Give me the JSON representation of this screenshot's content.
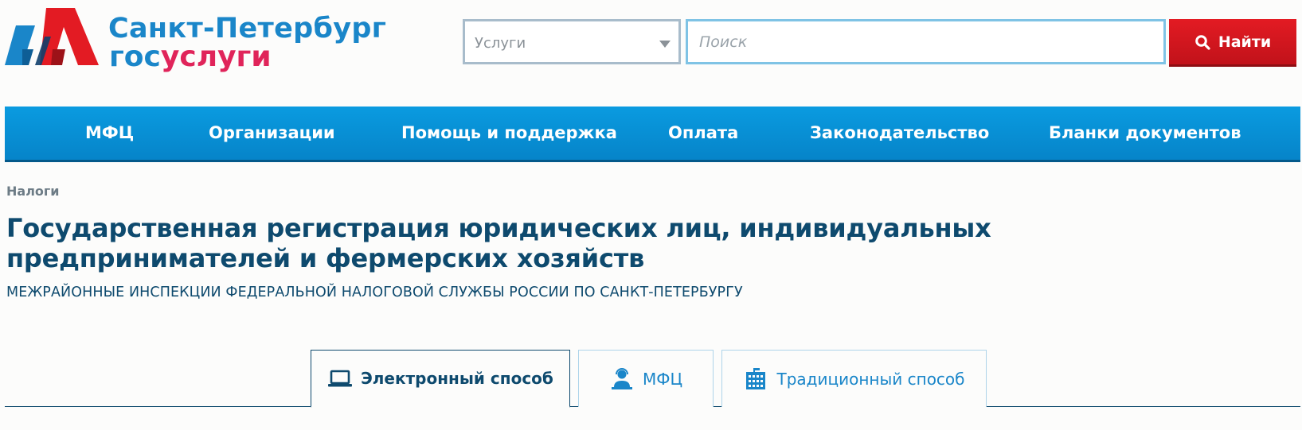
{
  "header": {
    "logo": {
      "title": "Санкт-Петербург",
      "sub_gos": "гос",
      "sub_uslugi": "услуги",
      "colors": {
        "blue": "#1a86c9",
        "red": "#e0245a",
        "mark_red": "#e31b23",
        "mark_blue": "#1a86c9"
      }
    },
    "search": {
      "category_value": "Услуги",
      "placeholder": "Поиск",
      "button_label": "Найти",
      "button_icon": "search-icon"
    }
  },
  "nav": {
    "items": [
      {
        "label": "МФЦ"
      },
      {
        "label": "Организации"
      },
      {
        "label": "Помощь и поддержка"
      },
      {
        "label": "Оплата"
      },
      {
        "label": "Законодательство"
      },
      {
        "label": "Бланки документов"
      }
    ],
    "color": "#0a9be0"
  },
  "breadcrumb": "Налоги",
  "page": {
    "title": "Государственная регистрация юридических лиц, индивидуальных предпринимателей и фермерских хозяйств",
    "subtitle": "МЕЖРАЙОННЫЕ ИНСПЕКЦИИ ФЕДЕРАЛЬНОЙ НАЛОГОВОЙ СЛУЖБЫ РОССИИ ПО САНКТ-ПЕТЕРБУРГУ"
  },
  "tabs": [
    {
      "label": "Электронный способ",
      "icon": "laptop-icon",
      "active": true
    },
    {
      "label": "МФЦ",
      "icon": "operator-icon",
      "active": false
    },
    {
      "label": "Традиционный способ",
      "icon": "building-icon",
      "active": false
    }
  ]
}
